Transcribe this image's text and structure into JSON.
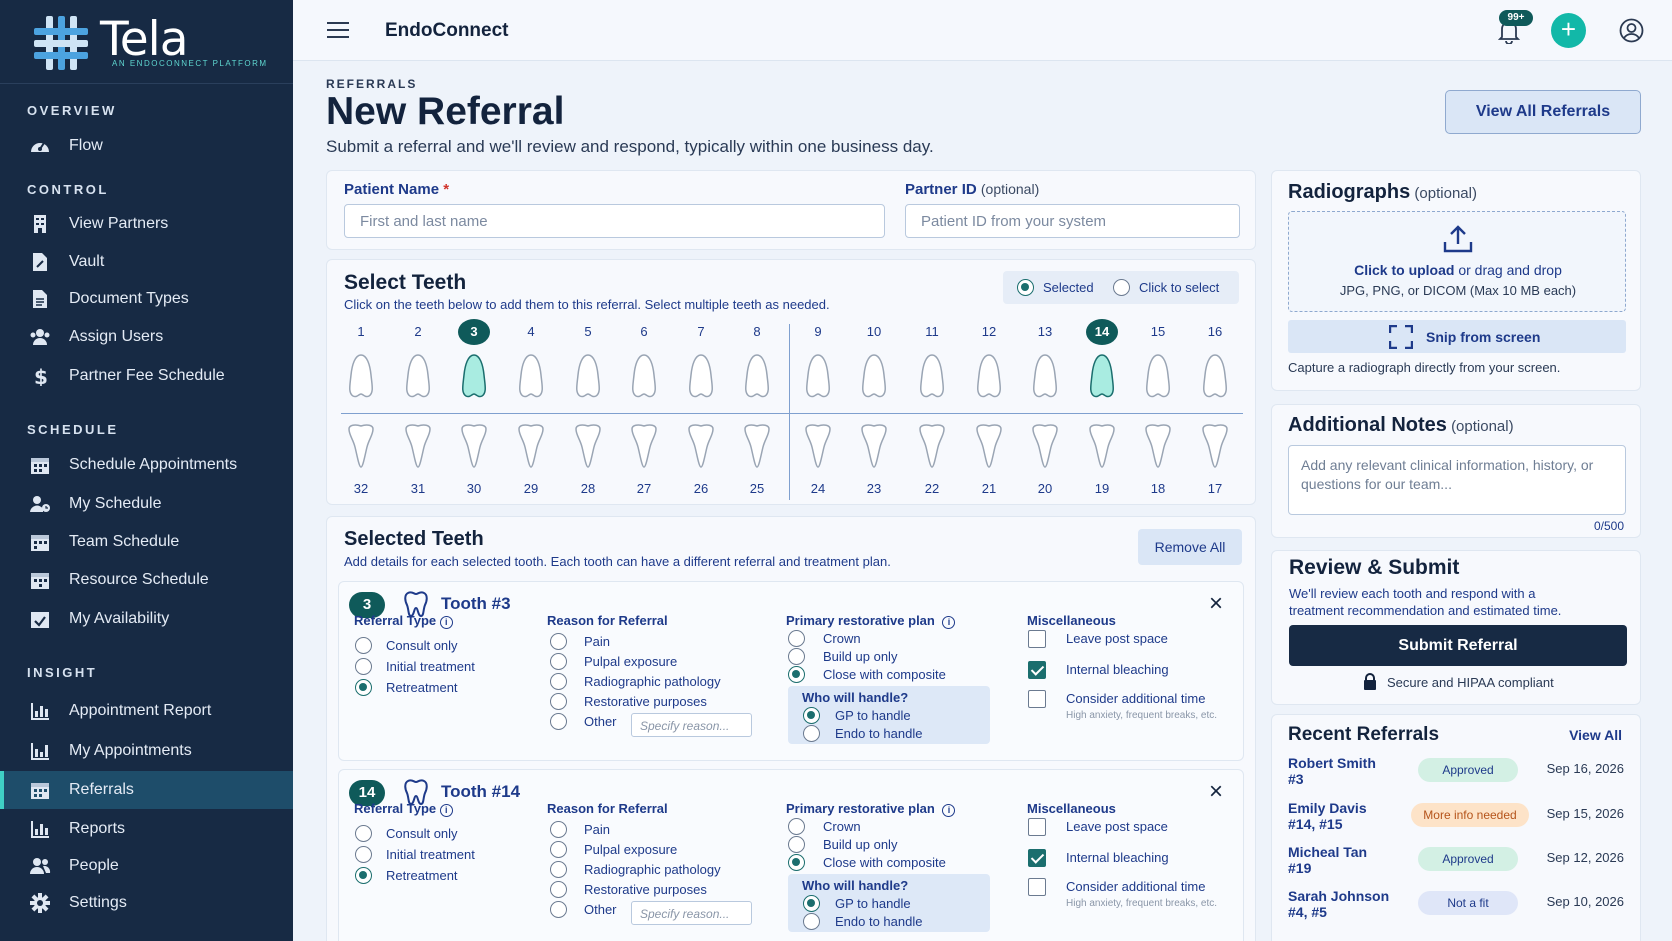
{
  "sidebar": {
    "logo_text": "Tela",
    "logo_tagline": "AN ENDOCONNECT PLATFORM",
    "sections": {
      "overview": "OVERVIEW",
      "control": "CONTROL",
      "schedule": "SCHEDULE",
      "insight": "INSIGHT"
    },
    "items": {
      "flow": "Flow",
      "view_partners": "View Partners",
      "vault": "Vault",
      "document_types": "Document Types",
      "assign_users": "Assign Users",
      "partner_fee_schedule": "Partner Fee Schedule",
      "schedule_appointments": "Schedule Appointments",
      "my_schedule": "My Schedule",
      "team_schedule": "Team Schedule",
      "resource_schedule": "Resource Schedule",
      "my_availability": "My Availability",
      "appointment_report": "Appointment Report",
      "my_appointments": "My Appointments",
      "referrals": "Referrals",
      "reports": "Reports",
      "people": "People",
      "settings": "Settings"
    },
    "active_item": "Referrals"
  },
  "topbar": {
    "app_name": "EndoConnect",
    "notification_count": "99+"
  },
  "header": {
    "breadcrumb": "REFERRALS",
    "title": "New Referral",
    "subtitle": "Submit a referral and we'll review and respond, typically within one business day.",
    "view_all_button": "View All Referrals"
  },
  "patient": {
    "name_label": "Patient Name",
    "required_mark": "*",
    "name_placeholder": "First and last name",
    "partner_label": "Partner ID",
    "partner_optional": "(optional)",
    "partner_placeholder": "Patient ID from your system"
  },
  "teeth_picker": {
    "title": "Select Teeth",
    "instructions": "Click on the teeth below to add them to this referral. Select multiple teeth as needed.",
    "legend_selected": "Selected",
    "legend_click": "Click to select",
    "upper": [
      "1",
      "2",
      "3",
      "4",
      "5",
      "6",
      "7",
      "8",
      "9",
      "10",
      "11",
      "12",
      "13",
      "14",
      "15",
      "16"
    ],
    "lower": [
      "32",
      "31",
      "30",
      "29",
      "28",
      "27",
      "26",
      "25",
      "24",
      "23",
      "22",
      "21",
      "20",
      "19",
      "18",
      "17"
    ],
    "selected": [
      "3",
      "14"
    ]
  },
  "selected_teeth": {
    "title": "Selected Teeth",
    "description": "Add details for each selected tooth. Each tooth can have a different referral and treatment plan.",
    "remove_all": "Remove All",
    "col_referral_type": "Referral Type",
    "col_reason": "Reason for Referral",
    "col_plan": "Primary restorative plan",
    "col_misc": "Miscellaneous",
    "who_handles": "Who will handle?",
    "referral_types": [
      "Consult only",
      "Initial treatment",
      "Retreatment"
    ],
    "reasons": [
      "Pain",
      "Pulpal exposure",
      "Radiographic pathology",
      "Restorative purposes",
      "Other"
    ],
    "other_placeholder": "Specify reason...",
    "plans": [
      "Crown",
      "Build up only",
      "Close with composite"
    ],
    "handlers": [
      "GP to handle",
      "Endo to handle"
    ],
    "misc": [
      "Leave post space",
      "Internal bleaching",
      "Consider additional time"
    ],
    "misc_hint": "High anxiety, frequent breaks, etc.",
    "cards": [
      {
        "number": "3",
        "title": "Tooth #3",
        "referral_type": "Retreatment",
        "plan": "Close with composite",
        "handler": "GP to handle",
        "misc_checked": [
          "Internal bleaching"
        ]
      },
      {
        "number": "14",
        "title": "Tooth #14",
        "referral_type": "Retreatment",
        "plan": "Close with composite",
        "handler": "GP to handle",
        "misc_checked": [
          "Internal bleaching"
        ]
      }
    ]
  },
  "radiographs": {
    "title": "Radiographs",
    "optional": "(optional)",
    "upload_link": "Click to upload",
    "upload_rest": "or drag and drop",
    "formats": "JPG, PNG, or DICOM (Max 10 MB each)",
    "snip_button": "Snip from screen",
    "snip_hint": "Capture a radiograph directly from your screen."
  },
  "notes": {
    "title": "Additional Notes",
    "optional": "(optional)",
    "placeholder": "Add any relevant clinical information, history, or questions for our team...",
    "counter": "0/500"
  },
  "review": {
    "title": "Review & Submit",
    "description": "We'll review each tooth and respond with a treatment recommendation and estimated time.",
    "submit_button": "Submit Referral",
    "secure_text": "Secure and HIPAA compliant"
  },
  "recent": {
    "title": "Recent Referrals",
    "view_all": "View All",
    "items": [
      {
        "name": "Robert Smith",
        "teeth": "#3",
        "status": "Approved",
        "date": "Sep 16, 2026"
      },
      {
        "name": "Emily Davis",
        "teeth": "#14, #15",
        "status": "More info needed",
        "date": "Sep 15, 2026"
      },
      {
        "name": "Micheal Tan",
        "teeth": "#19",
        "status": "Approved",
        "date": "Sep 12, 2026"
      },
      {
        "name": "Sarah Johnson",
        "teeth": "#4, #5",
        "status": "Not a fit",
        "date": "Sep 10, 2026"
      }
    ]
  },
  "colors": {
    "sidebar_bg": "#172a44",
    "accent_teal": "#0f5a5a",
    "link_blue": "#1e3a8a",
    "approved_bg": "#d3f0e4",
    "more_info_bg": "#fde3c8",
    "not_fit_bg": "#dfe6f8"
  }
}
